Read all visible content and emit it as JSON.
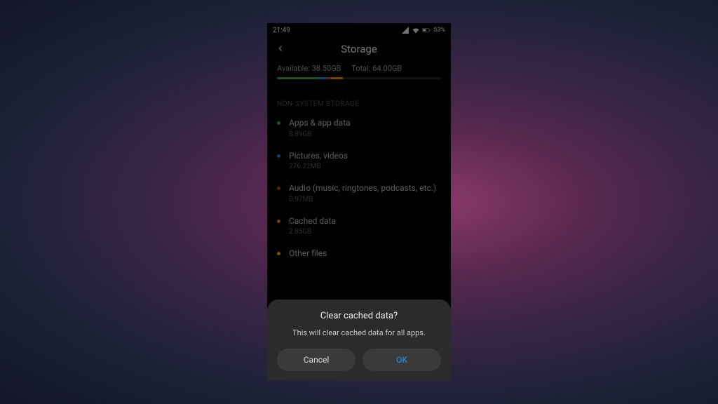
{
  "status": {
    "time": "21:49",
    "battery": "53"
  },
  "header": {
    "title": "Storage"
  },
  "summary": {
    "available_label": "Available:",
    "available_value": "38.50GB",
    "total_label": "Total:",
    "total_value": "64.00GB"
  },
  "section_header": "NON-SYSTEM STORAGE",
  "items": [
    {
      "label": "Apps & app data",
      "size": "8.89GB",
      "color": "green"
    },
    {
      "label": "Pictures, videos",
      "size": "276.22MB",
      "color": "blue"
    },
    {
      "label": "Audio (music, ringtones, podcasts, etc.)",
      "size": "0.97MB",
      "color": "red"
    },
    {
      "label": "Cached data",
      "size": "2.85GB",
      "color": "orange"
    },
    {
      "label": "Other files",
      "size": "",
      "color": "yellow"
    }
  ],
  "dialog": {
    "title": "Clear cached data?",
    "message": "This will clear cached data for all apps.",
    "cancel": "Cancel",
    "ok": "OK"
  }
}
